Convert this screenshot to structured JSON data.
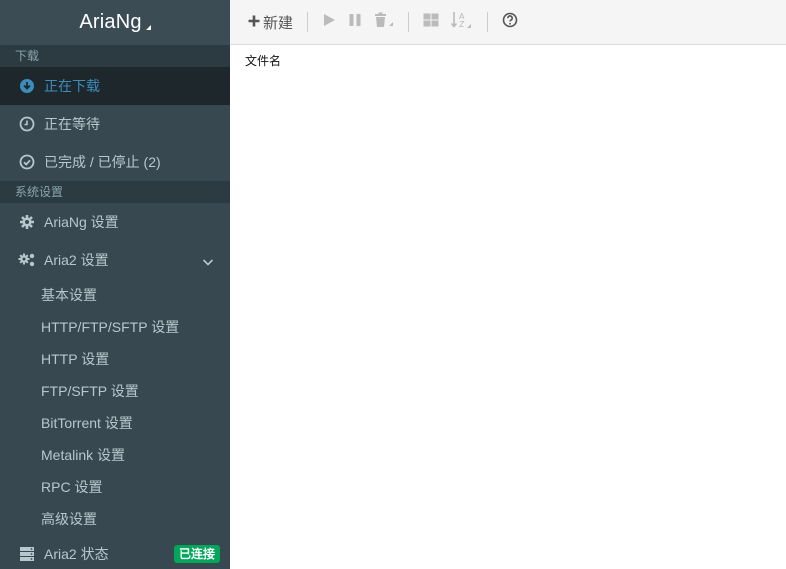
{
  "app": {
    "title": "AriaNg"
  },
  "sidebar": {
    "section_download": "下载",
    "downloading": "正在下载",
    "waiting": "正在等待",
    "stopped": "已完成 / 已停止 (2)",
    "section_settings": "系统设置",
    "ariang_settings": "AriaNg 设置",
    "aria2_settings": "Aria2 设置",
    "sub_items": [
      "基本设置",
      "HTTP/FTP/SFTP 设置",
      "HTTP 设置",
      "FTP/SFTP 设置",
      "BitTorrent 设置",
      "Metalink 设置",
      "RPC 设置",
      "高级设置"
    ],
    "aria2_status": "Aria2 状态",
    "status_badge": "已连接"
  },
  "toolbar": {
    "new_label": "新建"
  },
  "table": {
    "filename_header": "文件名"
  },
  "colors": {
    "sidebar_bg": "#374850",
    "active": "#3c8dbc",
    "badge": "#00a65a"
  }
}
